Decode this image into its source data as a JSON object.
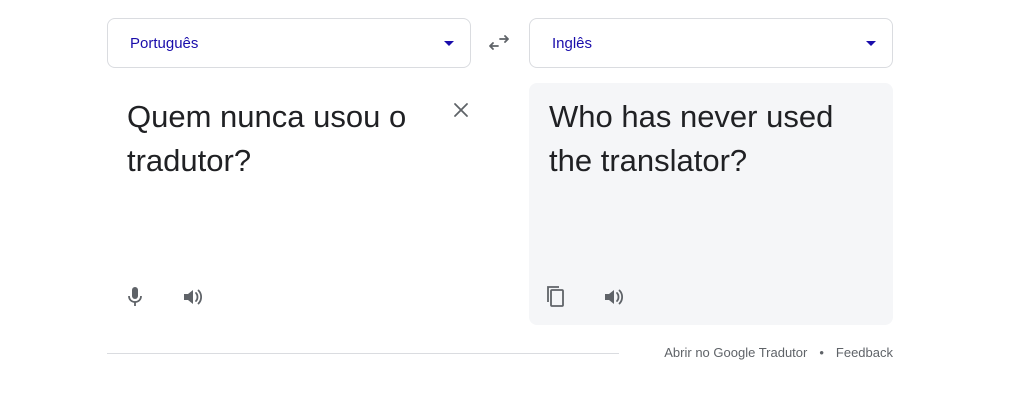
{
  "source_language": {
    "label": "Português"
  },
  "target_language": {
    "label": "Inglês"
  },
  "source_text": "Quem nunca usou o tradutor?",
  "translated_text": "Who has never used the translator?",
  "icons": {
    "swap": "swap-arrows-icon",
    "dropdown": "chevron-down-icon",
    "clear": "close-icon",
    "microphone": "microphone-icon",
    "speaker": "speaker-icon",
    "copy": "copy-icon"
  },
  "footer": {
    "open_link": "Abrir no Google Tradutor",
    "separator": "•",
    "feedback": "Feedback"
  },
  "colors": {
    "language_label": "#1a0dab",
    "text": "#202124",
    "icon": "#5f6368",
    "target_panel_bg": "#f5f6f8",
    "border": "#dadce0"
  }
}
